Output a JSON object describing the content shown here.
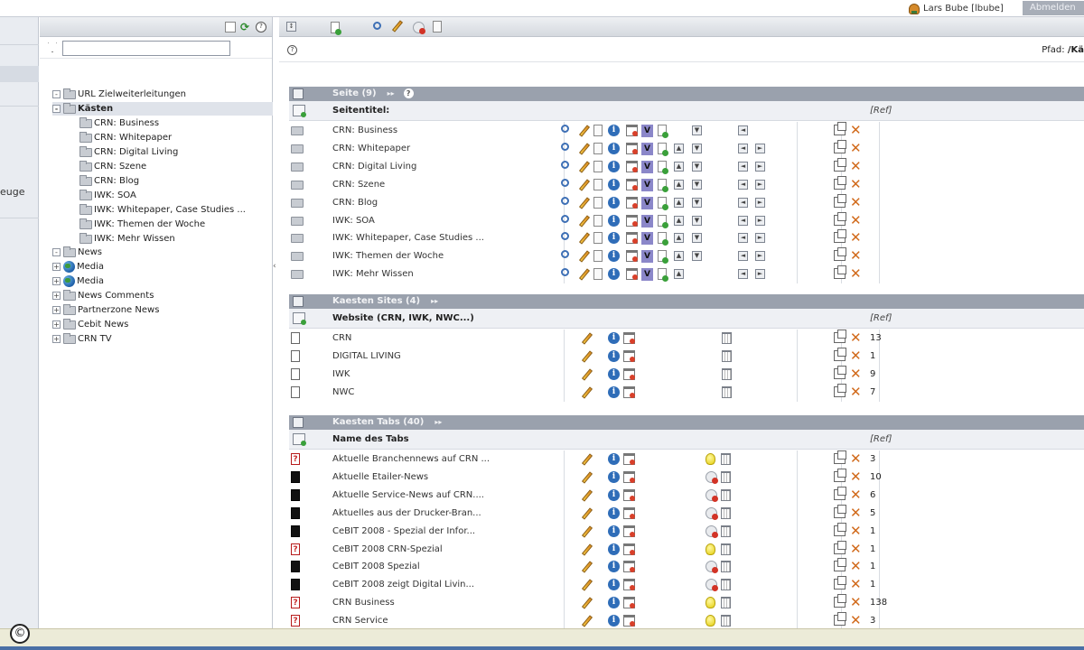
{
  "topbar": {
    "user": "Lars Bube [lbube]",
    "logout": "Abmelden"
  },
  "rail": {
    "label": "euge"
  },
  "tree": {
    "filter_value": "",
    "nodes": [
      {
        "label": "URL Zielweiterleitungen",
        "icon": "folder-icon",
        "expand": "-"
      },
      {
        "label": "Kästen",
        "icon": "folder-icon",
        "expand": "-",
        "selected": true
      },
      {
        "label": "CRN: Business",
        "icon": "folder-icon"
      },
      {
        "label": "CRN: Whitepaper",
        "icon": "folder-icon"
      },
      {
        "label": "CRN: Digital Living",
        "icon": "folder-icon"
      },
      {
        "label": "CRN: Szene",
        "icon": "folder-icon"
      },
      {
        "label": "CRN: Blog",
        "icon": "folder-icon"
      },
      {
        "label": "IWK: SOA",
        "icon": "folder-icon"
      },
      {
        "label": "IWK: Whitepaper, Case Studies ...",
        "icon": "folder-icon"
      },
      {
        "label": "IWK: Themen der Woche",
        "icon": "folder-icon"
      },
      {
        "label": "IWK: Mehr Wissen",
        "icon": "folder-icon"
      },
      {
        "label": "News",
        "icon": "folder-icon",
        "expand": "-"
      },
      {
        "label": "Media",
        "icon": "globe-icon",
        "expand": "+"
      },
      {
        "label": "Media",
        "icon": "globe-icon",
        "expand": "+"
      },
      {
        "label": "News Comments",
        "icon": "folder-icon",
        "expand": "+"
      },
      {
        "label": "Partnerzone News",
        "icon": "folder-icon",
        "expand": "+"
      },
      {
        "label": "Cebit News",
        "icon": "folder-icon",
        "expand": "+"
      },
      {
        "label": "CRN TV",
        "icon": "folder-icon",
        "expand": "+"
      }
    ]
  },
  "main": {
    "path_label": "Pfad:",
    "path_value": "/Kä",
    "sections": [
      {
        "title": "Seite (9)",
        "col_label": "Seitentitel:",
        "col_ref": "[Ref]",
        "rows": [
          {
            "label": "CRN: Business",
            "num": ""
          },
          {
            "label": "CRN: Whitepaper",
            "num": ""
          },
          {
            "label": "CRN: Digital Living",
            "num": ""
          },
          {
            "label": "CRN: Szene",
            "num": ""
          },
          {
            "label": "CRN: Blog",
            "num": ""
          },
          {
            "label": "IWK: SOA",
            "num": ""
          },
          {
            "label": "IWK: Whitepaper, Case Studies ...",
            "num": ""
          },
          {
            "label": "IWK: Themen der Woche",
            "num": ""
          },
          {
            "label": "IWK: Mehr Wissen",
            "num": ""
          }
        ]
      },
      {
        "title": "Kaesten Sites (4)",
        "col_label": "Website (CRN, IWK, NWC...)",
        "col_ref": "[Ref]",
        "rows": [
          {
            "label": "CRN",
            "num": "13"
          },
          {
            "label": "DIGITAL LIVING",
            "num": "1"
          },
          {
            "label": "IWK",
            "num": "9"
          },
          {
            "label": "NWC",
            "num": "7"
          }
        ]
      },
      {
        "title": "Kaesten Tabs (40)",
        "col_label": "Name des Tabs",
        "col_ref": "[Ref]",
        "rows": [
          {
            "label": "Aktuelle Branchennews auf CRN ...",
            "num": "3",
            "doc": "doc-red",
            "bulb": true
          },
          {
            "label": "Aktuelle Etailer-News",
            "num": "10",
            "doc": "doc-black",
            "bulb": false
          },
          {
            "label": "Aktuelle Service-News auf CRN....",
            "num": "6",
            "doc": "doc-black",
            "bulb": false
          },
          {
            "label": "Aktuelles aus der Drucker-Bran...",
            "num": "5",
            "doc": "doc-black",
            "bulb": false
          },
          {
            "label": "CeBIT 2008 - Spezial der Infor...",
            "num": "1",
            "doc": "doc-black",
            "bulb": false
          },
          {
            "label": "CeBIT 2008 CRN-Spezial",
            "num": "1",
            "doc": "doc-red",
            "bulb": true
          },
          {
            "label": "CeBIT 2008 Spezial",
            "num": "1",
            "doc": "doc-black",
            "bulb": false
          },
          {
            "label": "CeBIT 2008 zeigt Digital Livin...",
            "num": "1",
            "doc": "doc-black",
            "bulb": false
          },
          {
            "label": "CRN Business",
            "num": "138",
            "doc": "doc-red",
            "bulb": true
          },
          {
            "label": "CRN Service",
            "num": "3",
            "doc": "doc-red",
            "bulb": true
          }
        ]
      }
    ]
  },
  "status": {
    "badge": "©"
  }
}
